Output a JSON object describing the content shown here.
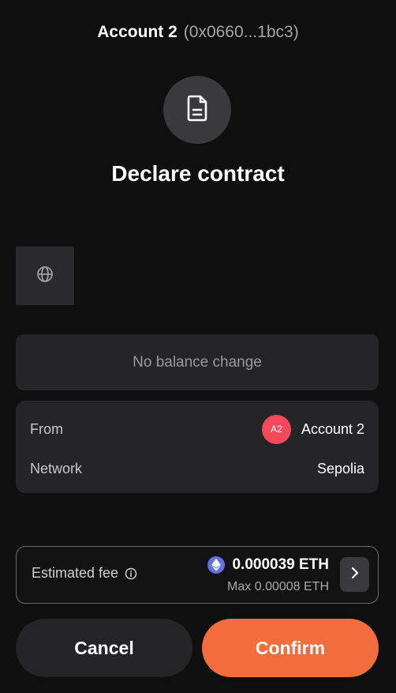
{
  "header": {
    "account_name": "Account 2",
    "account_address": "(0x0660...1bc3)"
  },
  "transaction": {
    "icon": "document-icon",
    "title": "Declare contract"
  },
  "dapp": {
    "icon": "globe-icon"
  },
  "balance": {
    "message": "No balance change"
  },
  "details": {
    "from_label": "From",
    "from_avatar": "A2",
    "from_value": "Account 2",
    "network_label": "Network",
    "network_value": "Sepolia"
  },
  "fee": {
    "label": "Estimated fee",
    "amount": "0.000039 ETH",
    "max": "Max 0.00008 ETH",
    "token_icon": "ethereum-icon"
  },
  "actions": {
    "cancel_label": "Cancel",
    "confirm_label": "Confirm"
  },
  "colors": {
    "background": "#0f0f10",
    "card": "#252527",
    "accent": "#f26d3d",
    "avatar": "#f4495b",
    "eth": "#6272e3"
  }
}
